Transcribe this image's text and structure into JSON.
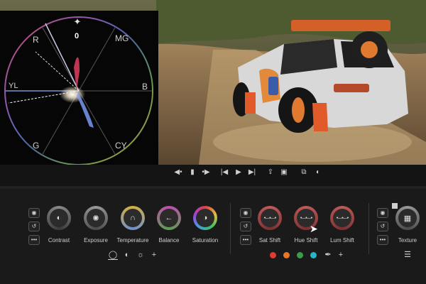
{
  "scope": {
    "count": "0",
    "labels": {
      "r": "R",
      "mg": "MG",
      "yl": "YL",
      "b": "B",
      "g": "G",
      "cy": "CY"
    }
  },
  "transport": {
    "icons": [
      "mark-in-icon",
      "bookmark-icon",
      "mark-out-icon",
      "go-start-icon",
      "play-icon",
      "go-end-icon",
      "export-icon",
      "crop-icon",
      "compare-icon",
      "split-view-icon"
    ]
  },
  "light_group": {
    "knobs": [
      {
        "label": "Contrast",
        "icon": "contrast-icon"
      },
      {
        "label": "Exposure",
        "icon": "aperture-icon"
      },
      {
        "label": "Temperature",
        "icon": "thermometer-icon"
      },
      {
        "label": "Balance",
        "icon": "arrow-left-icon"
      },
      {
        "label": "Saturation",
        "icon": "saturation-icon"
      }
    ],
    "tools": [
      "globe-icon",
      "half-circle-icon",
      "sun-icon",
      "plus-icon"
    ]
  },
  "hsl_group": {
    "knobs": [
      {
        "label": "Sat Shift"
      },
      {
        "label": "Hue Shift"
      },
      {
        "label": "Lum Shift"
      }
    ],
    "swatches": [
      "#e23b32",
      "#e8752a",
      "#3a9d4a",
      "#27b4c9"
    ],
    "tools": [
      "eyedropper-icon",
      "plus-icon"
    ]
  },
  "texture_group": {
    "knob": {
      "label": "Texture",
      "icon": "texture-icon"
    },
    "tools": [
      "sliders-icon"
    ]
  },
  "colors": {
    "accent": "#c94a3b"
  }
}
